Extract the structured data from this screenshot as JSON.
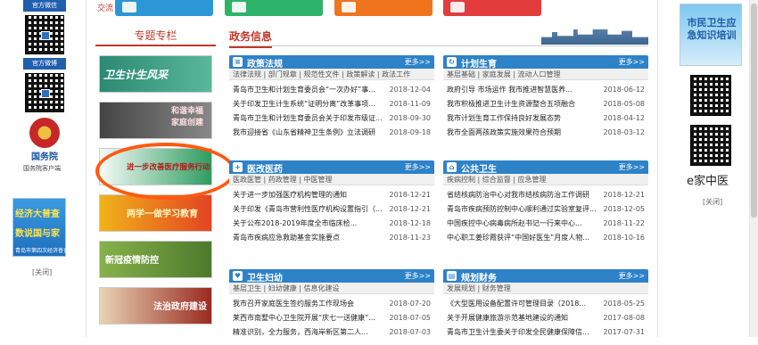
{
  "left": {
    "tag_weixin": "官方微信",
    "tag_weibo": "官方微博",
    "gwy_label": "国务院",
    "gwy_caption": "国务院客户端",
    "promo_line1": "经济大普查",
    "promo_line2": "数说国与家",
    "promo_line3": "青岛市第四次经济普查",
    "close": "[关闭]"
  },
  "top": {
    "label": "交流"
  },
  "special": {
    "header": "专题专栏",
    "banners": [
      "卫生计生风采",
      "和谐幸福 家庭创建",
      "进一步改善医疗服务行动",
      "两学一做学习教育",
      "新冠疫情防控",
      "法治政府建设"
    ]
  },
  "news": {
    "header": "政务信息",
    "boxes": [
      {
        "title": "政策法规",
        "more": "更多>>",
        "sub": "法律法规 | 部门规章 | 规范性文件 | 政策解读 | 政法工作",
        "items": [
          {
            "t": "青岛市卫生和计划生育委员会“一次办好”事...",
            "d": "2018-12-04"
          },
          {
            "t": "关于印发卫生计生系统“证明分离”改革事项...",
            "d": "2018-11-09"
          },
          {
            "t": "青岛市卫生和计划生育委员会关于印发市级证...",
            "d": "2018-09-30"
          },
          {
            "t": "我市迎接省《山东省精神卫生条例》立法调研",
            "d": "2018-09-18"
          }
        ]
      },
      {
        "title": "计划生育",
        "more": "更多>>",
        "sub": "基层基础 | 家庭发展 | 流动人口管理",
        "items": [
          {
            "t": "政府引导 市场运作 我市推进智慧医养...",
            "d": "2018-06-12"
          },
          {
            "t": "我市积极推进卫生计生资源整合五项融合",
            "d": "2018-05-08"
          },
          {
            "t": "我市计划生育工作保持良好发展态势",
            "d": "2018-04-12"
          },
          {
            "t": "我市全面两孩政策实施效果符合预期",
            "d": "2018-03-12"
          }
        ]
      },
      {
        "title": "医改医药",
        "more": "更多>>",
        "sub": "医政医管 | 药政管理 | 中医管理",
        "items": [
          {
            "t": "关于进一步加强医疗机构管理的通知",
            "d": "2018-12-21"
          },
          {
            "t": "关于印发《青岛市营利性医疗机构设置指引（...",
            "d": "2018-12-21"
          },
          {
            "t": "关于公布2018-2019年度全市临床检...",
            "d": "2018-12-18"
          },
          {
            "t": "青岛市疾病应急救助基金实施要点",
            "d": "2018-11-23"
          }
        ]
      },
      {
        "title": "公共卫生",
        "more": "更多>>",
        "sub": "疾病控制 | 综合监督 | 应急管理",
        "items": [
          {
            "t": "省结核病防治中心对我市结核病防治工作调研",
            "d": "2018-12-21"
          },
          {
            "t": "青岛市疾病预防控制中心顺利通过实验室复评...",
            "d": "2018-12-05"
          },
          {
            "t": "中国疾控中心病毒病所赵书记一行来中心...",
            "d": "2018-11-22"
          },
          {
            "t": "中心职工姜珍霞获评“中国好医生”月度人物...",
            "d": "2018-10-16"
          }
        ]
      },
      {
        "title": "卫生妇幼",
        "more": "更多>>",
        "sub": "基层卫生 | 妇幼健康 | 信息化建设",
        "items": [
          {
            "t": "我市召开家庭医生签约服务工作现场会",
            "d": "2018-07-20"
          },
          {
            "t": "莱西市南墅中心卫生院开展“庆七一送健康”...",
            "d": "2018-07-05"
          },
          {
            "t": "精准识别，全力服务，西海岸新区第二人...",
            "d": "2018-07-03"
          }
        ]
      },
      {
        "title": "规划财务",
        "more": "更多>>",
        "sub": "发展规划 | 财务管理",
        "items": [
          {
            "t": "《大型医用设备配置许可管理目录（2018...",
            "d": "2018-05-25"
          },
          {
            "t": "关于开展健康旅游示范基地建设的通知",
            "d": "2017-08-08"
          },
          {
            "t": "青岛市卫生计生委关于印发全民健康保障信...",
            "d": "2017-07-31"
          }
        ]
      }
    ]
  },
  "right": {
    "banner_text": "市民卫生应急知识培训",
    "label": "e家中医",
    "close": "[关闭]"
  },
  "colors": {
    "accent": "#c0392b",
    "box_blue": "#2e82c8",
    "oval": "#ff5a12"
  }
}
